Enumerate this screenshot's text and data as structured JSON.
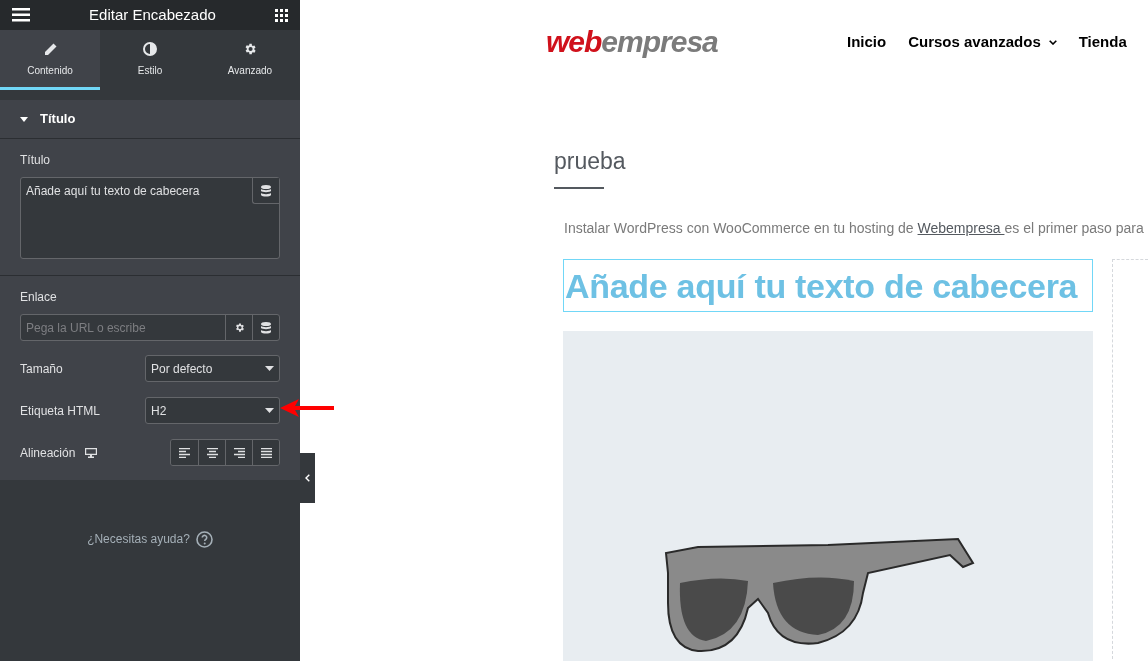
{
  "panel": {
    "title": "Editar Encabezado",
    "tabs": [
      {
        "label": "Contenido",
        "selected": true
      },
      {
        "label": "Estilo",
        "selected": false
      },
      {
        "label": "Avanzado",
        "selected": false
      }
    ],
    "section": {
      "title": "Título",
      "expanded": true
    },
    "title_field": {
      "label": "Título",
      "value": "Añade aquí tu texto de cabecera"
    },
    "link_field": {
      "label": "Enlace",
      "placeholder": "Pega la URL o escribe"
    },
    "size_select": {
      "label": "Tamaño",
      "value": "Por defecto"
    },
    "tag_select": {
      "label": "Etiqueta HTML",
      "value": "H2"
    },
    "alignment": {
      "label": "Alineación"
    },
    "help": "¿Necesitas ayuda?"
  },
  "site": {
    "logo": {
      "part_1": "web",
      "part_2": "empresa"
    },
    "nav": [
      {
        "label": "Inicio",
        "dropdown": false
      },
      {
        "label": "Cursos avanzados",
        "dropdown": true
      },
      {
        "label": "Tienda",
        "dropdown": false
      }
    ],
    "page_title": "prueba",
    "intro": {
      "before": "Instalar WordPress con WooCommerce en tu hosting de",
      "link": "Webempresa ",
      "after": "es el primer paso para"
    },
    "heading": "Añade aquí tu texto de cabecera"
  }
}
